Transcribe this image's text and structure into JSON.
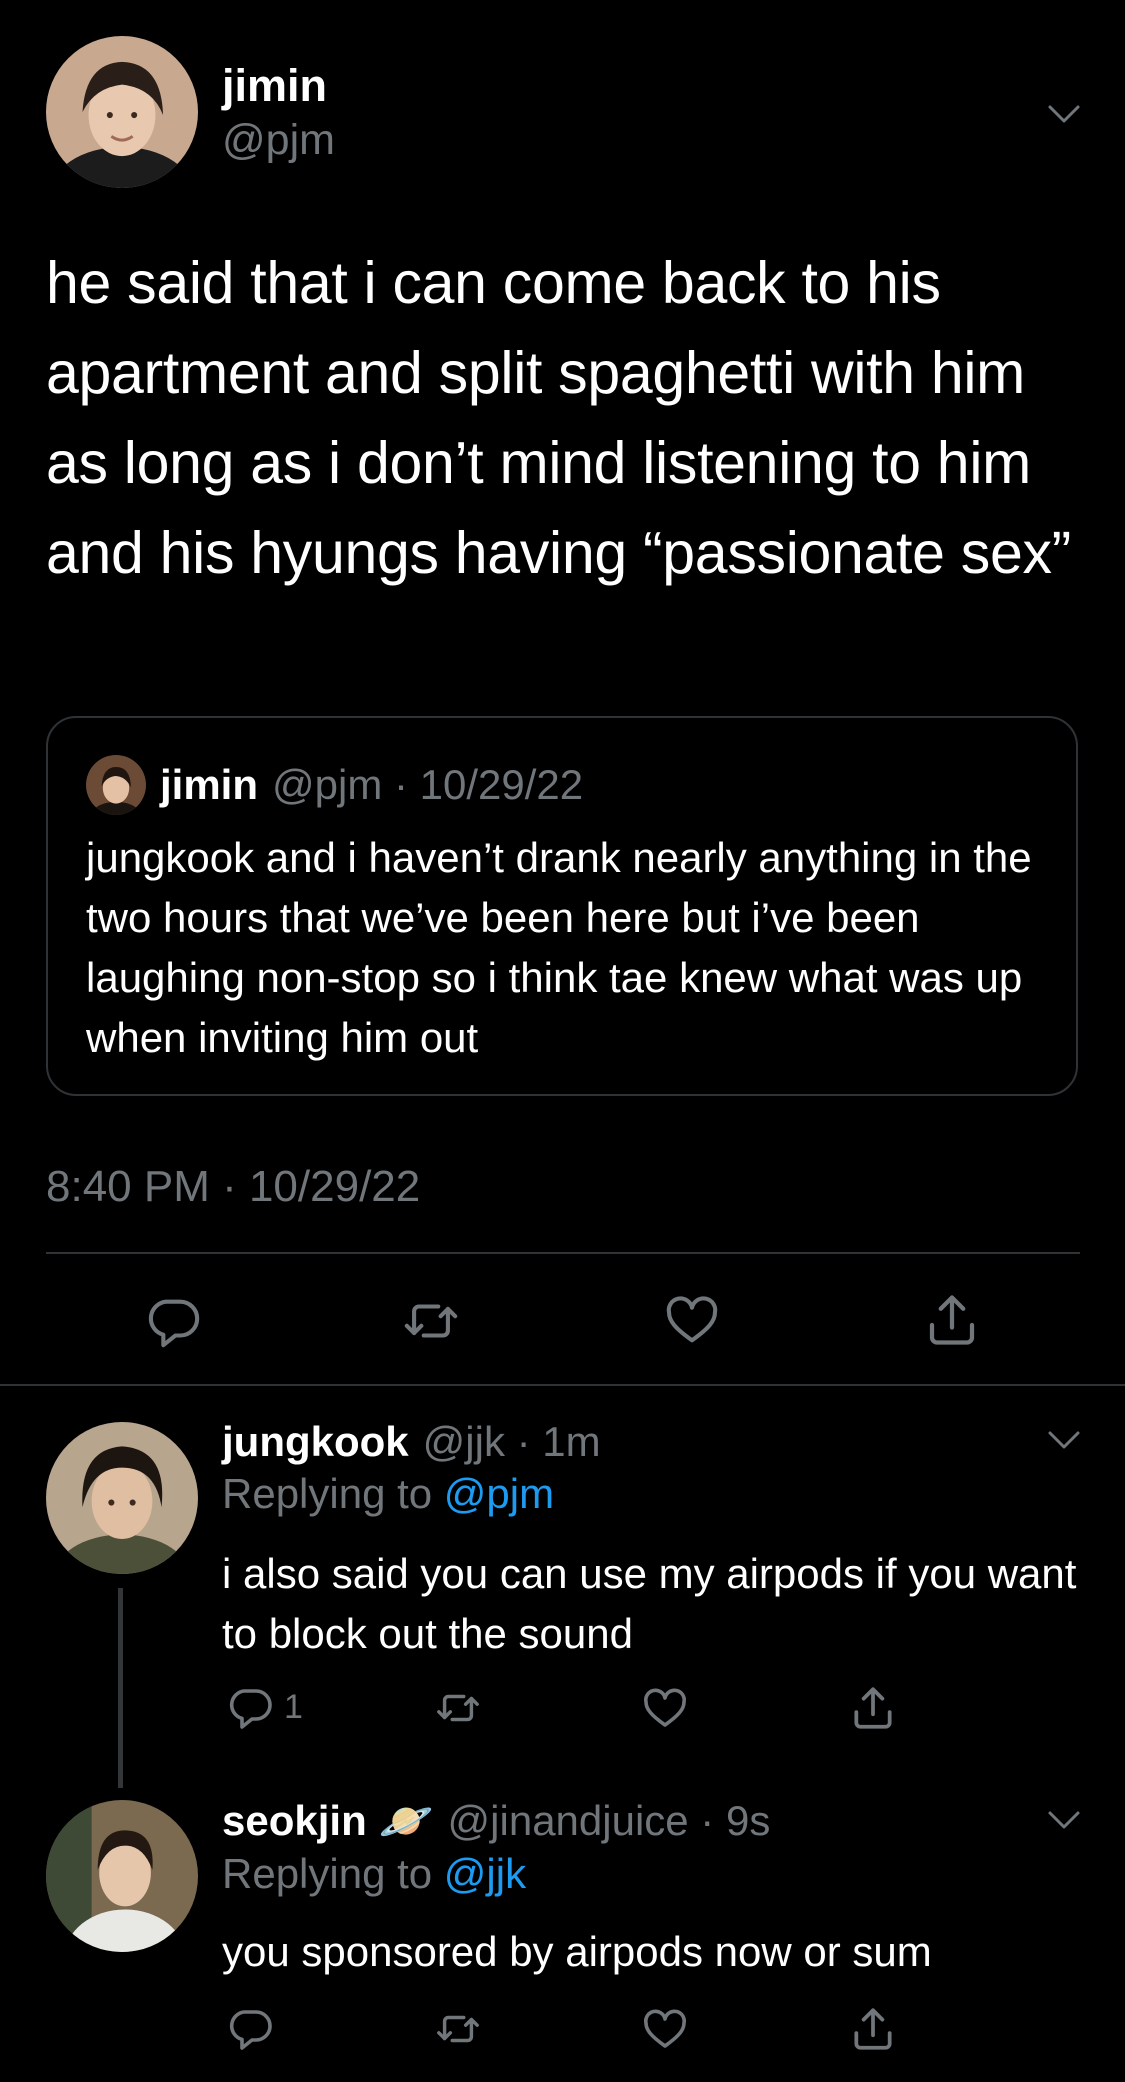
{
  "main_tweet": {
    "name": "jimin",
    "handle": "@pjm",
    "text": "he said that i can come back to his apartment and split spaghetti with him as long as i don’t mind listening to him and his hyungs having “passionate sex”",
    "timestamp": "8:40 PM · 10/29/22",
    "quoted": {
      "name": "jimin",
      "handle_time": "@pjm · 10/29/22",
      "text": "jungkook and i haven’t drank nearly anything in the two hours that we’ve been here but i’ve been laughing non-stop so i think tae knew what was up when inviting him out"
    },
    "actions": [
      "reply-icon",
      "retweet-icon",
      "like-icon",
      "share-icon"
    ]
  },
  "replies": [
    {
      "name": "jungkook",
      "handle_time": "@jjk · 1m",
      "replying_prefix": "Replying to ",
      "replying_to": "@pjm",
      "text": "i also said you can use my airpods if you want to block out the sound",
      "reply_count": "1"
    },
    {
      "name": "seokjin",
      "emoji": "🪐",
      "handle_time": "@jinandjuice · 9s",
      "replying_prefix": "Replying to ",
      "replying_to": "@jjk",
      "text": "you sponsored by airpods now or sum",
      "reply_count": ""
    }
  ],
  "colors": {
    "background": "#000000",
    "text": "#e7e9ea",
    "secondary": "#71767b",
    "link": "#1d9bf0",
    "divider": "#2f3336"
  }
}
